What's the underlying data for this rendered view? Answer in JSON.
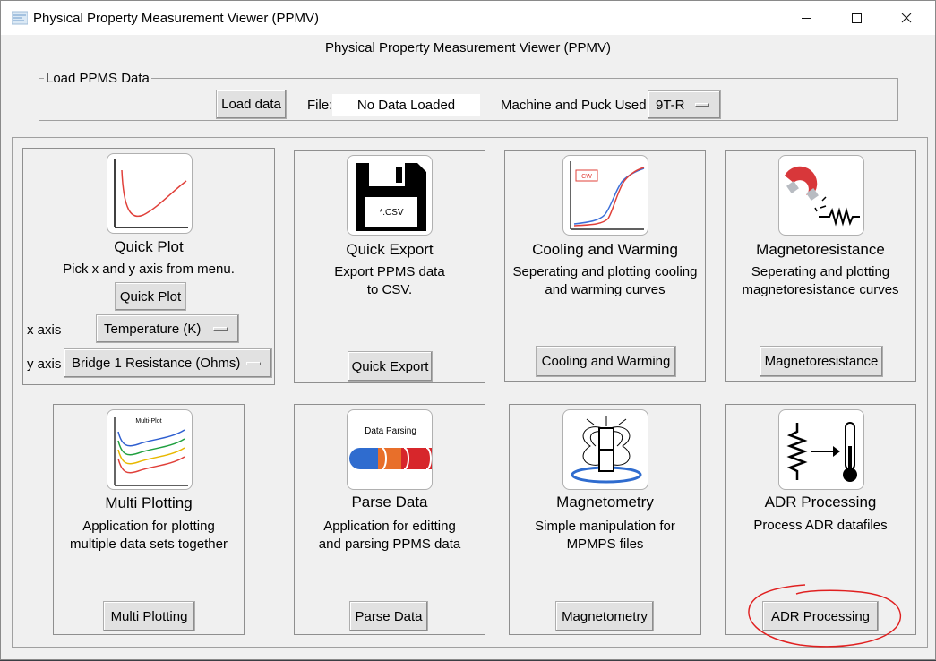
{
  "window": {
    "title": "Physical Property Measurement Viewer (PPMV)",
    "inner_title": "Physical Property Measurement Viewer (PPMV)",
    "controls": {
      "minimize": "—",
      "maximize": "☐",
      "close": "✕"
    }
  },
  "load_section": {
    "legend": "Load PPMS Data",
    "load_button": "Load data",
    "file_label": "File:",
    "file_value": "No Data Loaded",
    "machine_label": "Machine and Puck Used:",
    "machine_value": "9T-R"
  },
  "panels": {
    "quick_plot": {
      "icon": "plot-curve-icon",
      "title": "Quick Plot",
      "desc": [
        "Pick x and y axis from menu."
      ],
      "button": "Quick Plot",
      "x_label": "x axis",
      "x_value": "Temperature (K)",
      "y_label": "y axis",
      "y_value": "Bridge 1 Resistance (Ohms)"
    },
    "quick_export": {
      "icon": "floppy-disk-icon",
      "icon_text": "*.CSV",
      "title": "Quick Export",
      "desc": [
        "Export PPMS data",
        "to CSV."
      ],
      "button": "Quick Export"
    },
    "cooling_warming": {
      "icon": "cooling-warming-plot-icon",
      "icon_text": "CW",
      "title": "Cooling and Warming",
      "desc": [
        "Seperating and plotting cooling",
        "and warming curves"
      ],
      "button": "Cooling and Warming"
    },
    "magnetoresistance": {
      "icon": "magnet-resistor-icon",
      "title": "Magnetoresistance",
      "desc": [
        "Seperating and plotting",
        "magnetoresistance curves"
      ],
      "button": "Magnetoresistance"
    },
    "multi_plotting": {
      "icon": "multi-plot-icon",
      "icon_text": "Multi-Plot",
      "title": "Multi Plotting",
      "desc": [
        "Application for plotting",
        "multiple data sets together"
      ],
      "button": "Multi Plotting"
    },
    "parse_data": {
      "icon": "data-parsing-icon",
      "icon_text": "Data Parsing",
      "title": "Parse Data",
      "desc": [
        "Application for editting",
        "and parsing PPMS data"
      ],
      "button": "Parse Data"
    },
    "magnetometry": {
      "icon": "magnetometry-icon",
      "title": "Magnetometry",
      "desc": [
        "Simple manipulation for",
        "MPMPS files"
      ],
      "button": "Magnetometry"
    },
    "adr_processing": {
      "icon": "resistor-thermometer-icon",
      "title": "ADR Processing",
      "desc": [
        "Process ADR datafiles"
      ],
      "button": "ADR Processing"
    }
  },
  "colors": {
    "window_bg": "#f0f0f0",
    "button_bg": "#e1e1e1",
    "annotation": "#e02020"
  }
}
